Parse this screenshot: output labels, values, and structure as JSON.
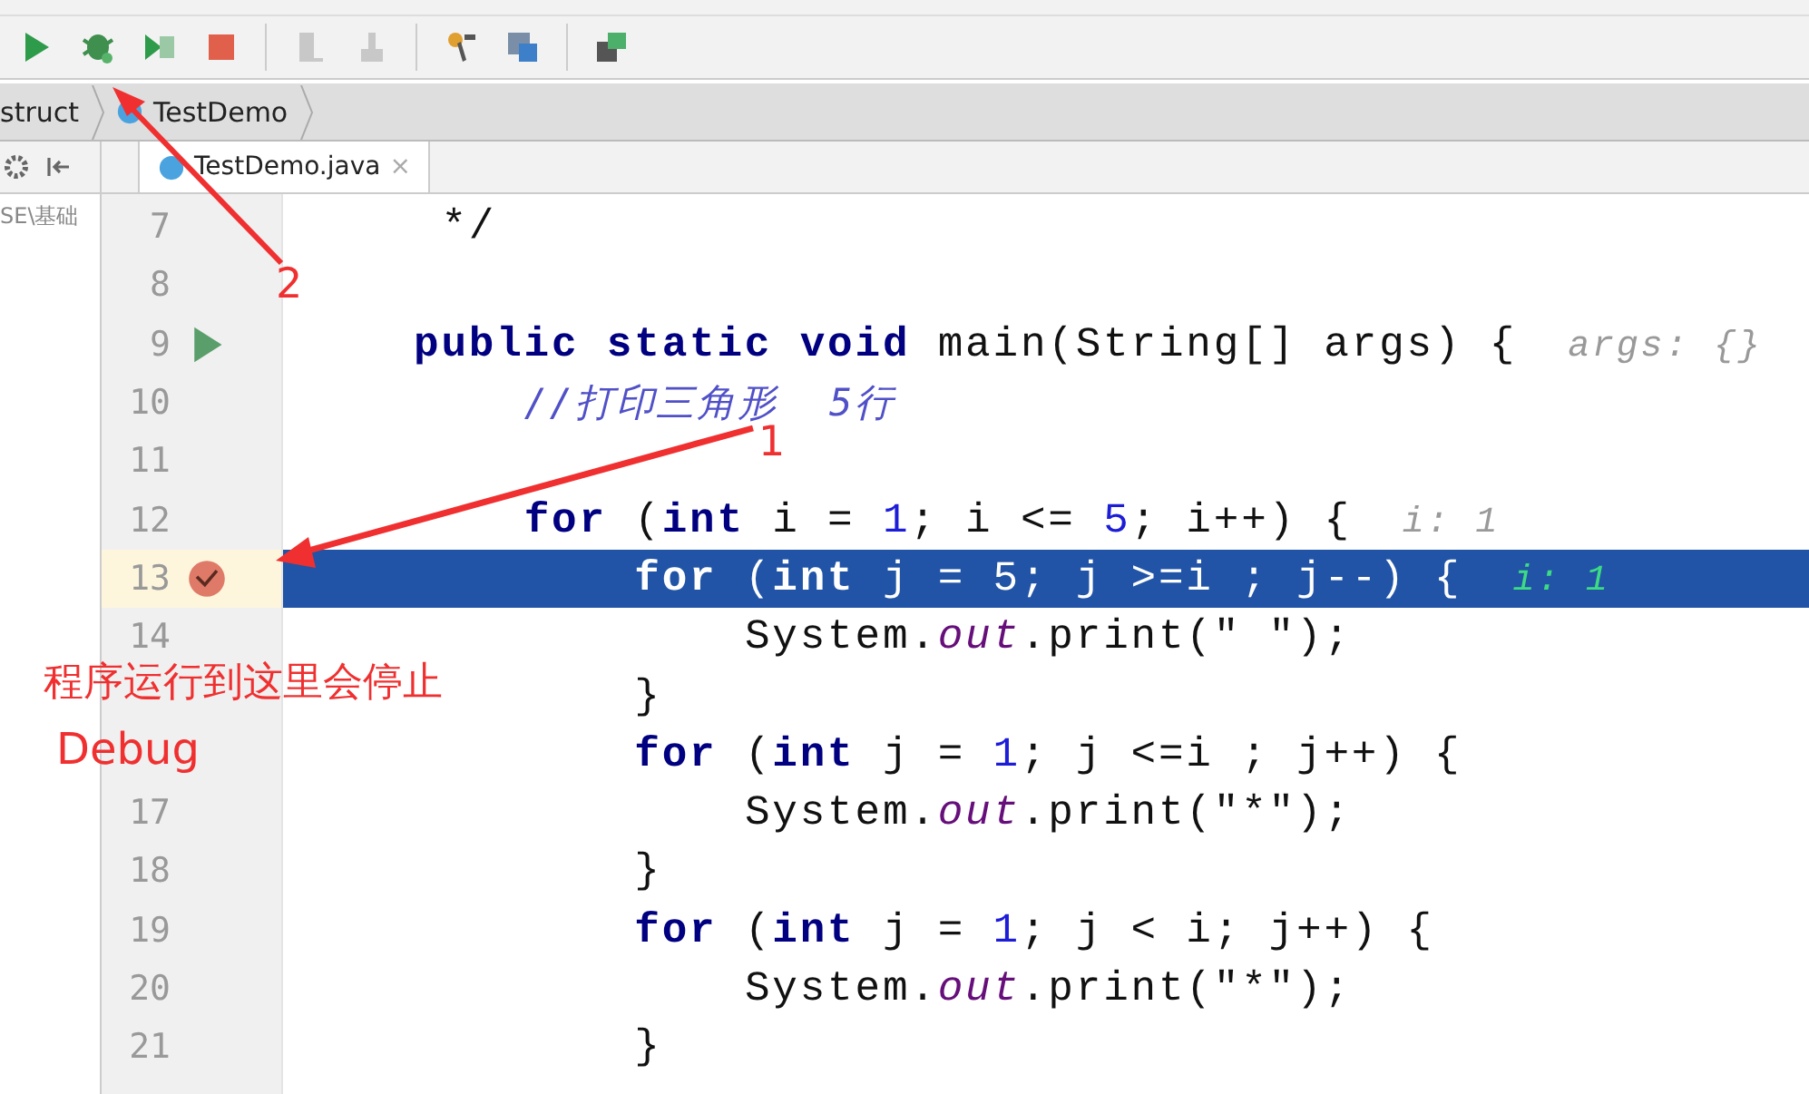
{
  "breadcrumb": [
    "struct",
    "TestDemo"
  ],
  "project_panel": {
    "path": "SE\\基础"
  },
  "tabs": [
    {
      "label": "TestDemo.java",
      "selected": true,
      "close": "×"
    }
  ],
  "lines": [
    {
      "number": "7",
      "kind": "plain",
      "current": false,
      "tokens": [
        {
          "kind": "plain",
          "t": " */"
        }
      ]
    },
    {
      "number": "8",
      "kind": "plain",
      "current": false
    },
    {
      "number": "9",
      "kind": "run",
      "current": false,
      "tokens": [
        {
          "kind": "kw",
          "t": "public static void "
        },
        {
          "kind": "plain",
          "t": "main(String[] args) {"
        },
        {
          "kind": "hint",
          "t": "args: {}"
        }
      ]
    },
    {
      "number": "10",
      "kind": "plain",
      "current": false,
      "tokens": [
        {
          "kind": "comment",
          "t": "    //打印三角形  5行"
        }
      ]
    },
    {
      "number": "11",
      "kind": "plain",
      "current": false
    },
    {
      "number": "12",
      "kind": "plain",
      "current": false,
      "tokens": [
        {
          "kind": "kw",
          "t": "    for "
        },
        {
          "kind": "plain",
          "t": "("
        },
        {
          "kind": "kw",
          "t": "int "
        },
        {
          "kind": "plain",
          "t": "i = "
        },
        {
          "kind": "num",
          "t": "1"
        },
        {
          "kind": "plain",
          "t": "; i <= "
        },
        {
          "kind": "num",
          "t": "5"
        },
        {
          "kind": "plain",
          "t": "; i++) {"
        },
        {
          "kind": "hint",
          "t": "i: 1"
        }
      ]
    },
    {
      "number": "13",
      "kind": "breakpoint",
      "current": true,
      "tokens": [
        {
          "kind": "kw",
          "t": "        for "
        },
        {
          "kind": "plain",
          "t": "("
        },
        {
          "kind": "kw",
          "t": "int "
        },
        {
          "kind": "plain",
          "t": "j = "
        },
        {
          "kind": "num",
          "t": "5"
        },
        {
          "kind": "plain",
          "t": "; j >=i ; j--) {"
        },
        {
          "kind": "hint",
          "t": "i: 1"
        }
      ]
    },
    {
      "number": "14",
      "kind": "plain",
      "current": false,
      "tokens": [
        {
          "kind": "plain",
          "t": "            System."
        },
        {
          "kind": "field",
          "t": "out"
        },
        {
          "kind": "plain",
          "t": ".print("
        },
        {
          "kind": "str",
          "t": "\" \""
        },
        {
          "kind": "plain",
          "t": ");"
        }
      ]
    },
    {
      "kind": "plain",
      "current": false,
      "tokens": [
        {
          "kind": "plain",
          "t": "        }"
        }
      ]
    },
    {
      "kind": "plain",
      "current": false,
      "tokens": [
        {
          "kind": "kw",
          "t": "        for "
        },
        {
          "kind": "plain",
          "t": "("
        },
        {
          "kind": "kw",
          "t": "int "
        },
        {
          "kind": "plain",
          "t": "j = "
        },
        {
          "kind": "num",
          "t": "1"
        },
        {
          "kind": "plain",
          "t": "; j <=i ; j++) {"
        }
      ]
    },
    {
      "number": "17",
      "kind": "plain",
      "current": false,
      "tokens": [
        {
          "kind": "plain",
          "t": "            System."
        },
        {
          "kind": "field",
          "t": "out"
        },
        {
          "kind": "plain",
          "t": ".print("
        },
        {
          "kind": "str",
          "t": "\"*\""
        },
        {
          "kind": "plain",
          "t": ");"
        }
      ]
    },
    {
      "number": "18",
      "kind": "plain",
      "current": false,
      "tokens": [
        {
          "kind": "plain",
          "t": "        }"
        }
      ]
    },
    {
      "number": "19",
      "kind": "plain",
      "current": false,
      "tokens": [
        {
          "kind": "kw",
          "t": "        for "
        },
        {
          "kind": "plain",
          "t": "("
        },
        {
          "kind": "kw",
          "t": "int "
        },
        {
          "kind": "plain",
          "t": "j = "
        },
        {
          "kind": "num",
          "t": "1"
        },
        {
          "kind": "plain",
          "t": "; j < i; j++) {"
        }
      ]
    },
    {
      "number": "20",
      "kind": "plain",
      "current": false,
      "tokens": [
        {
          "kind": "plain",
          "t": "            System."
        },
        {
          "kind": "field",
          "t": "out"
        },
        {
          "kind": "plain",
          "t": ".print("
        },
        {
          "kind": "str",
          "t": "\"*\""
        },
        {
          "kind": "plain",
          "t": ");"
        }
      ]
    },
    {
      "number": "21",
      "kind": "plain",
      "current": false,
      "tokens": [
        {
          "kind": "plain",
          "t": "        }"
        }
      ]
    }
  ],
  "annotations": {
    "arrow_labels": [
      "1",
      "2"
    ],
    "note": [
      "程序运行到这里会停止",
      "Debug"
    ]
  }
}
